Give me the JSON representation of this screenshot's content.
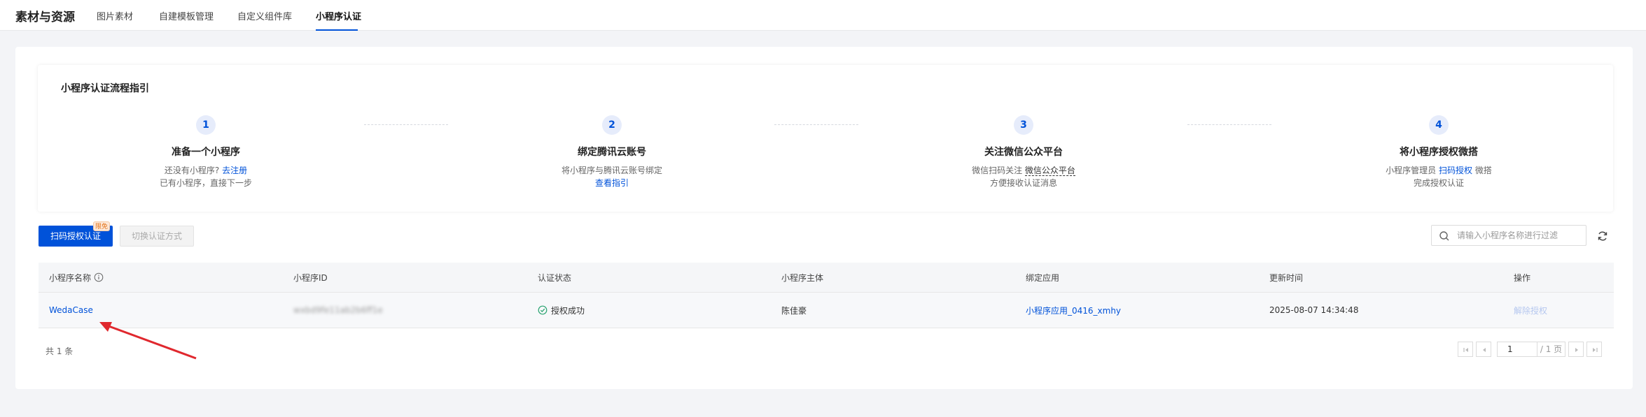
{
  "header": {
    "title": "素材与资源",
    "tabs": [
      {
        "label": "图片素材"
      },
      {
        "label": "自建模板管理"
      },
      {
        "label": "自定义组件库"
      },
      {
        "label": "小程序认证"
      }
    ],
    "active_tab": "小程序认证"
  },
  "guide": {
    "title": "小程序认证流程指引",
    "steps": [
      {
        "num": "1",
        "title": "准备一个小程序",
        "desc1": "还没有小程序?",
        "link1": "去注册",
        "desc2": "已有小程序，直接下一步"
      },
      {
        "num": "2",
        "title": "绑定腾讯云账号",
        "desc1": "将小程序与腾讯云账号绑定",
        "link1": "查看指引"
      },
      {
        "num": "3",
        "title": "关注微信公众平台",
        "desc1": "微信扫码关注",
        "link1": "微信公众平台",
        "desc2": "方便接收认证消息"
      },
      {
        "num": "4",
        "title": "将小程序授权微搭",
        "desc1": "小程序管理员",
        "link1": "扫码授权",
        "desc1b": "微搭",
        "desc2": "完成授权认证"
      }
    ]
  },
  "toolbar": {
    "scan_button": "扫码授权认证",
    "badge": "限免",
    "switch_button": "切换认证方式",
    "search_placeholder": "请输入小程序名称进行过滤"
  },
  "table": {
    "columns": [
      "小程序名称",
      "小程序ID",
      "认证状态",
      "小程序主体",
      "绑定应用",
      "更新时间",
      "操作"
    ],
    "rows": [
      {
        "name": "WedaCase",
        "id": "wxbd9fe11ab2b6ff1e",
        "status": "授权成功",
        "owner": "陈佳豪",
        "app": "小程序应用_0416_xmhy",
        "updated": "2025-08-07 14:34:48",
        "action": "解除授权"
      }
    ]
  },
  "pagination": {
    "total": "共 1 条",
    "page": "1",
    "page_total": "/ 1 页"
  },
  "colors": {
    "primary": "#0052d9",
    "success": "#2ba471",
    "annotation": "#e0282e"
  }
}
